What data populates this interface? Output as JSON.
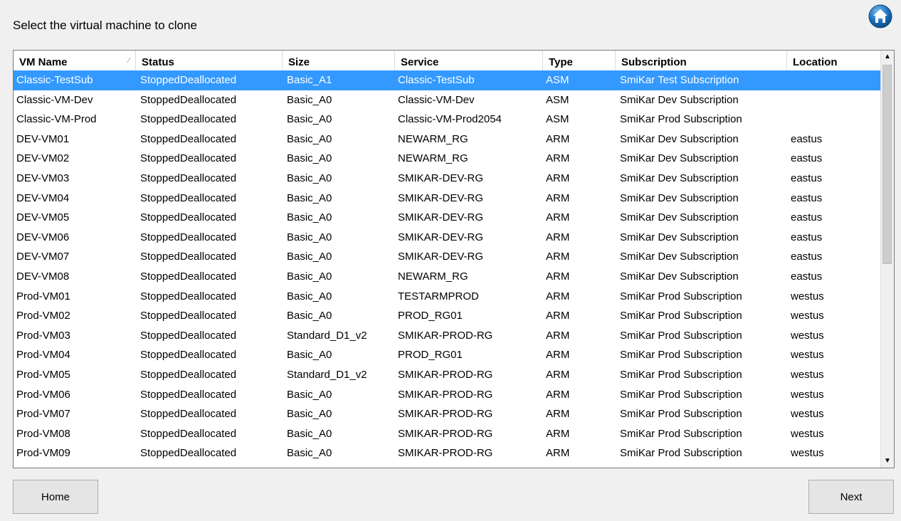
{
  "title": "Select the virtual machine to clone",
  "header_icon": "home-icon",
  "columns": [
    "VM Name",
    "Status",
    "Size",
    "Service",
    "Type",
    "Subscription",
    "Location"
  ],
  "sort_column": "VM Name",
  "selected_row": 0,
  "rows": [
    [
      "Classic-TestSub",
      "StoppedDeallocated",
      "Basic_A1",
      "Classic-TestSub",
      "ASM",
      "SmiKar Test Subscription",
      ""
    ],
    [
      "Classic-VM-Dev",
      "StoppedDeallocated",
      "Basic_A0",
      "Classic-VM-Dev",
      "ASM",
      "SmiKar Dev Subscription",
      ""
    ],
    [
      "Classic-VM-Prod",
      "StoppedDeallocated",
      "Basic_A0",
      "Classic-VM-Prod2054",
      "ASM",
      "SmiKar Prod Subscription",
      ""
    ],
    [
      "DEV-VM01",
      "StoppedDeallocated",
      "Basic_A0",
      "NEWARM_RG",
      "ARM",
      "SmiKar Dev Subscription",
      "eastus"
    ],
    [
      "DEV-VM02",
      "StoppedDeallocated",
      "Basic_A0",
      "NEWARM_RG",
      "ARM",
      "SmiKar Dev Subscription",
      "eastus"
    ],
    [
      "DEV-VM03",
      "StoppedDeallocated",
      "Basic_A0",
      "SMIKAR-DEV-RG",
      "ARM",
      "SmiKar Dev Subscription",
      "eastus"
    ],
    [
      "DEV-VM04",
      "StoppedDeallocated",
      "Basic_A0",
      "SMIKAR-DEV-RG",
      "ARM",
      "SmiKar Dev Subscription",
      "eastus"
    ],
    [
      "DEV-VM05",
      "StoppedDeallocated",
      "Basic_A0",
      "SMIKAR-DEV-RG",
      "ARM",
      "SmiKar Dev Subscription",
      "eastus"
    ],
    [
      "DEV-VM06",
      "StoppedDeallocated",
      "Basic_A0",
      "SMIKAR-DEV-RG",
      "ARM",
      "SmiKar Dev Subscription",
      "eastus"
    ],
    [
      "DEV-VM07",
      "StoppedDeallocated",
      "Basic_A0",
      "SMIKAR-DEV-RG",
      "ARM",
      "SmiKar Dev Subscription",
      "eastus"
    ],
    [
      "DEV-VM08",
      "StoppedDeallocated",
      "Basic_A0",
      "NEWARM_RG",
      "ARM",
      "SmiKar Dev Subscription",
      "eastus"
    ],
    [
      "Prod-VM01",
      "StoppedDeallocated",
      "Basic_A0",
      "TESTARMPROD",
      "ARM",
      "SmiKar Prod Subscription",
      "westus"
    ],
    [
      "Prod-VM02",
      "StoppedDeallocated",
      "Basic_A0",
      "PROD_RG01",
      "ARM",
      "SmiKar Prod Subscription",
      "westus"
    ],
    [
      "Prod-VM03",
      "StoppedDeallocated",
      "Standard_D1_v2",
      "SMIKAR-PROD-RG",
      "ARM",
      "SmiKar Prod Subscription",
      "westus"
    ],
    [
      "Prod-VM04",
      "StoppedDeallocated",
      "Basic_A0",
      "PROD_RG01",
      "ARM",
      "SmiKar Prod Subscription",
      "westus"
    ],
    [
      "Prod-VM05",
      "StoppedDeallocated",
      "Standard_D1_v2",
      "SMIKAR-PROD-RG",
      "ARM",
      "SmiKar Prod Subscription",
      "westus"
    ],
    [
      "Prod-VM06",
      "StoppedDeallocated",
      "Basic_A0",
      "SMIKAR-PROD-RG",
      "ARM",
      "SmiKar Prod Subscription",
      "westus"
    ],
    [
      "Prod-VM07",
      "StoppedDeallocated",
      "Basic_A0",
      "SMIKAR-PROD-RG",
      "ARM",
      "SmiKar Prod Subscription",
      "westus"
    ],
    [
      "Prod-VM08",
      "StoppedDeallocated",
      "Basic_A0",
      "SMIKAR-PROD-RG",
      "ARM",
      "SmiKar Prod Subscription",
      "westus"
    ],
    [
      "Prod-VM09",
      "StoppedDeallocated",
      "Basic_A0",
      "SMIKAR-PROD-RG",
      "ARM",
      "SmiKar Prod Subscription",
      "westus"
    ]
  ],
  "buttons": {
    "home": "Home",
    "next": "Next"
  },
  "colors": {
    "selection": "#3399ff",
    "home_icon": "#1e73be"
  }
}
